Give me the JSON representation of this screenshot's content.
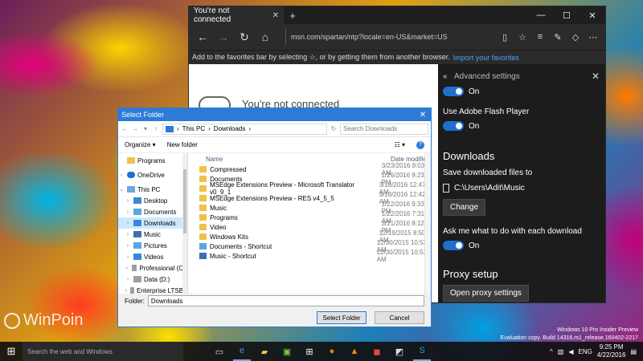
{
  "edge": {
    "tab_title": "You're not connected",
    "close_tab": "✕",
    "new_tab": "+",
    "window_min": "—",
    "window_max": "☐",
    "window_close": "✕",
    "back": "←",
    "forward": "→",
    "refresh": "↻",
    "home": "⌂",
    "url": "msn.com/spartan/ntp?locale=en-US&market=US",
    "fav_message": "Add to the favorites bar by selecting ☆, or by getting them from another browser.",
    "fav_link": "Import your favorites",
    "page_heading": "You're not connected"
  },
  "settings": {
    "title": "Advanced settings",
    "toggle1_state": "On",
    "flash_label": "Use Adobe Flash Player",
    "flash_state": "On",
    "downloads_heading": "Downloads",
    "save_label": "Save downloaded files to",
    "save_path": "C:\\Users\\Adit\\Music",
    "change_button": "Change",
    "ask_label": "Ask me what to do with each download",
    "ask_state": "On",
    "proxy_heading": "Proxy setup",
    "proxy_button": "Open proxy settings"
  },
  "dialog": {
    "title": "Select Folder",
    "breadcrumb_root": "This PC",
    "breadcrumb_current": "Downloads",
    "search_placeholder": "Search Downloads",
    "organize": "Organize ▾",
    "new_folder": "New folder",
    "col_name": "Name",
    "col_date": "Date modified",
    "nav": [
      {
        "label": "Programs",
        "icon": "folder"
      },
      {
        "label": "OneDrive",
        "icon": "onedrive"
      },
      {
        "label": "This PC",
        "icon": "pc"
      },
      {
        "label": "Desktop",
        "icon": "desktop"
      },
      {
        "label": "Documents",
        "icon": "documents"
      },
      {
        "label": "Downloads",
        "icon": "downloads"
      },
      {
        "label": "Music",
        "icon": "music"
      },
      {
        "label": "Pictures",
        "icon": "pictures"
      },
      {
        "label": "Videos",
        "icon": "videos"
      },
      {
        "label": "Professional (C:)",
        "icon": "disk"
      },
      {
        "label": "Data (D:)",
        "icon": "disk"
      },
      {
        "label": "Enterprise LTSB (",
        "icon": "disk"
      }
    ],
    "files": [
      {
        "name": "Compressed",
        "date": "3/23/2016 9:03 AM",
        "icon": "folder"
      },
      {
        "name": "Documents",
        "date": "1/26/2016 9:23 PM",
        "icon": "folder"
      },
      {
        "name": "MSEdge Extensions Preview - Microsoft Translator v0_9_1",
        "date": "3/18/2016 12:47 AM",
        "icon": "folder"
      },
      {
        "name": "MSEdge Extensions Preview - RES v4_5_5",
        "date": "3/18/2016 12:42 AM",
        "icon": "folder"
      },
      {
        "name": "Music",
        "date": "1/22/2016 9:33 PM",
        "icon": "folder"
      },
      {
        "name": "Programs",
        "date": "1/22/2016 7:31 AM",
        "icon": "folder"
      },
      {
        "name": "Video",
        "date": "3/21/2016 8:12 PM",
        "icon": "folder"
      },
      {
        "name": "Windows Kits",
        "date": "12/19/2015 8:50 AM",
        "icon": "folder"
      },
      {
        "name": "Documents - Shortcut",
        "date": "12/30/2015 10:53 AM",
        "icon": "shortcut"
      },
      {
        "name": "Music - Shortcut",
        "date": "12/30/2015 10:53 AM",
        "icon": "music-shortcut"
      }
    ],
    "folder_label": "Folder:",
    "folder_value": "Downloads",
    "select_button": "Select Folder",
    "cancel_button": "Cancel"
  },
  "watermark": {
    "brand": "WinPoin",
    "eval_line1": "Windows 10 Pro Insider Preview",
    "eval_line2": "Evaluation copy. Build 14316.rs1_release.160402-2217"
  },
  "taskbar": {
    "search_placeholder": "Search the web and Windows",
    "language": "ENG",
    "time": "9:25 PM",
    "date": "4/22/2016"
  }
}
